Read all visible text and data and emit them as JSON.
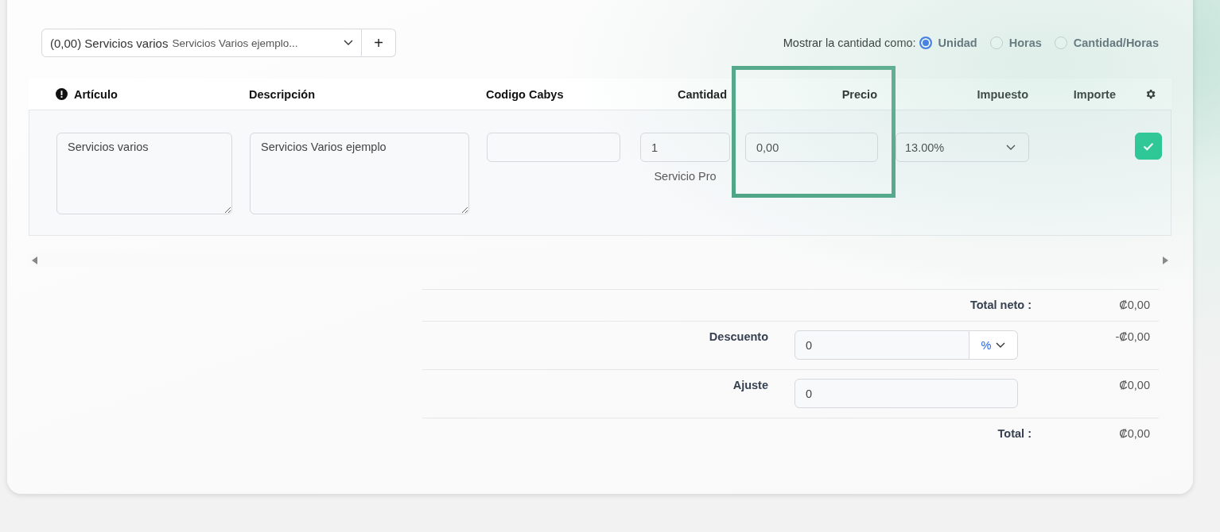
{
  "item_picker": {
    "value": "(0,00) Servicios varios",
    "description": "Servicios Varios ejemplo..."
  },
  "add_button": "+",
  "quantity_display": {
    "label": "Mostrar la cantidad como:",
    "options": [
      {
        "label": "Unidad",
        "selected": true
      },
      {
        "label": "Horas",
        "selected": false
      },
      {
        "label": "Cantidad/Horas",
        "selected": false
      }
    ]
  },
  "table": {
    "columns": [
      {
        "label": "Artículo",
        "required": true
      },
      {
        "label": "Descripción",
        "required": false
      },
      {
        "label": "Codigo Cabys",
        "required": false
      },
      {
        "label": "Cantidad",
        "required": false
      },
      {
        "label": "Precio",
        "required": false
      },
      {
        "label": "Impuesto",
        "required": false
      },
      {
        "label": "Importe",
        "required": false
      }
    ],
    "rows": [
      {
        "article": "Servicios varios",
        "description": "Servicios Varios ejemplo",
        "quantity": "1",
        "quantity_note": "Servicio Pro",
        "price": "0,00",
        "tax": "13.00%",
        "checked": true
      }
    ]
  },
  "summary": [
    {
      "kind": "total",
      "label": "Total neto :",
      "value": "₡0,00"
    },
    {
      "kind": "discount",
      "label": "Descuento",
      "input": "0",
      "unit": "%",
      "value": "-₡0,00"
    },
    {
      "kind": "adjust",
      "label": "Ajuste",
      "input": "0",
      "value": "₡0,00"
    },
    {
      "kind": "total",
      "label": "Total :",
      "value": "₡0,00"
    }
  ]
}
